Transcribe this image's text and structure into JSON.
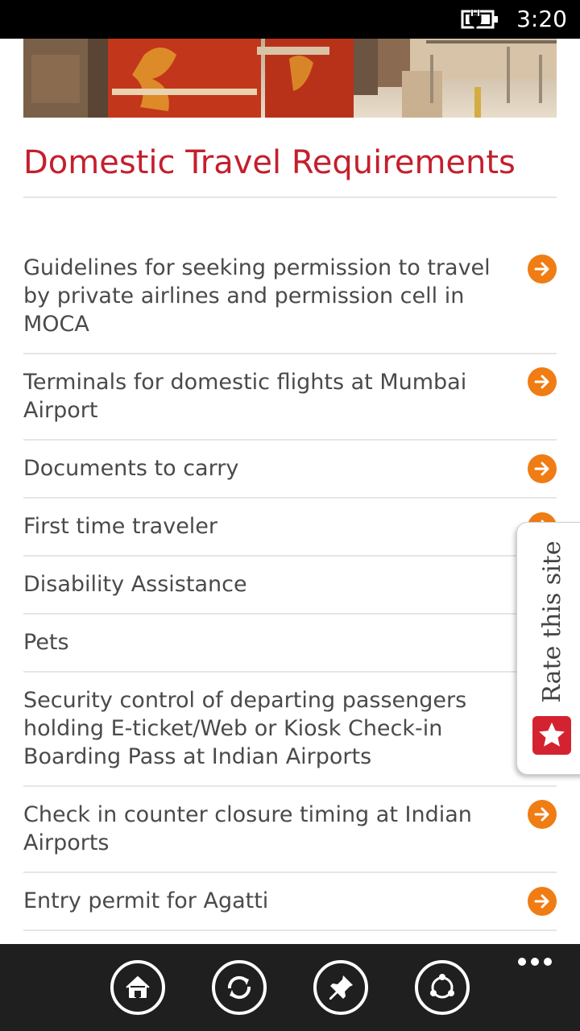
{
  "status_bar": {
    "time": "3:20"
  },
  "page": {
    "title": "Domestic Travel Requirements"
  },
  "items": [
    {
      "label": "Guidelines for seeking permission to travel by private airlines and permission cell in MOCA"
    },
    {
      "label": "Terminals for domestic flights at Mumbai Airport"
    },
    {
      "label": "Documents to carry"
    },
    {
      "label": "First time traveler"
    },
    {
      "label": "Disability Assistance"
    },
    {
      "label": "Pets"
    },
    {
      "label": "Security control of departing passengers holding E-ticket/Web or Kiosk Check-in Boarding Pass at Indian Airports"
    },
    {
      "label": "Check in counter closure timing at Indian Airports"
    },
    {
      "label": "Entry permit for Agatti"
    }
  ],
  "rate_tab": {
    "label": "Rate this site"
  },
  "app_bar": {
    "buttons": [
      {
        "icon": "home-icon"
      },
      {
        "icon": "refresh-icon"
      },
      {
        "icon": "pin-icon"
      },
      {
        "icon": "share-icon"
      }
    ],
    "more_icon": "ellipsis-icon"
  },
  "colors": {
    "accent": "#c41f2d",
    "arrow": "#f07c14",
    "app_bar": "#1f1f1f",
    "status_bar": "#000000"
  }
}
